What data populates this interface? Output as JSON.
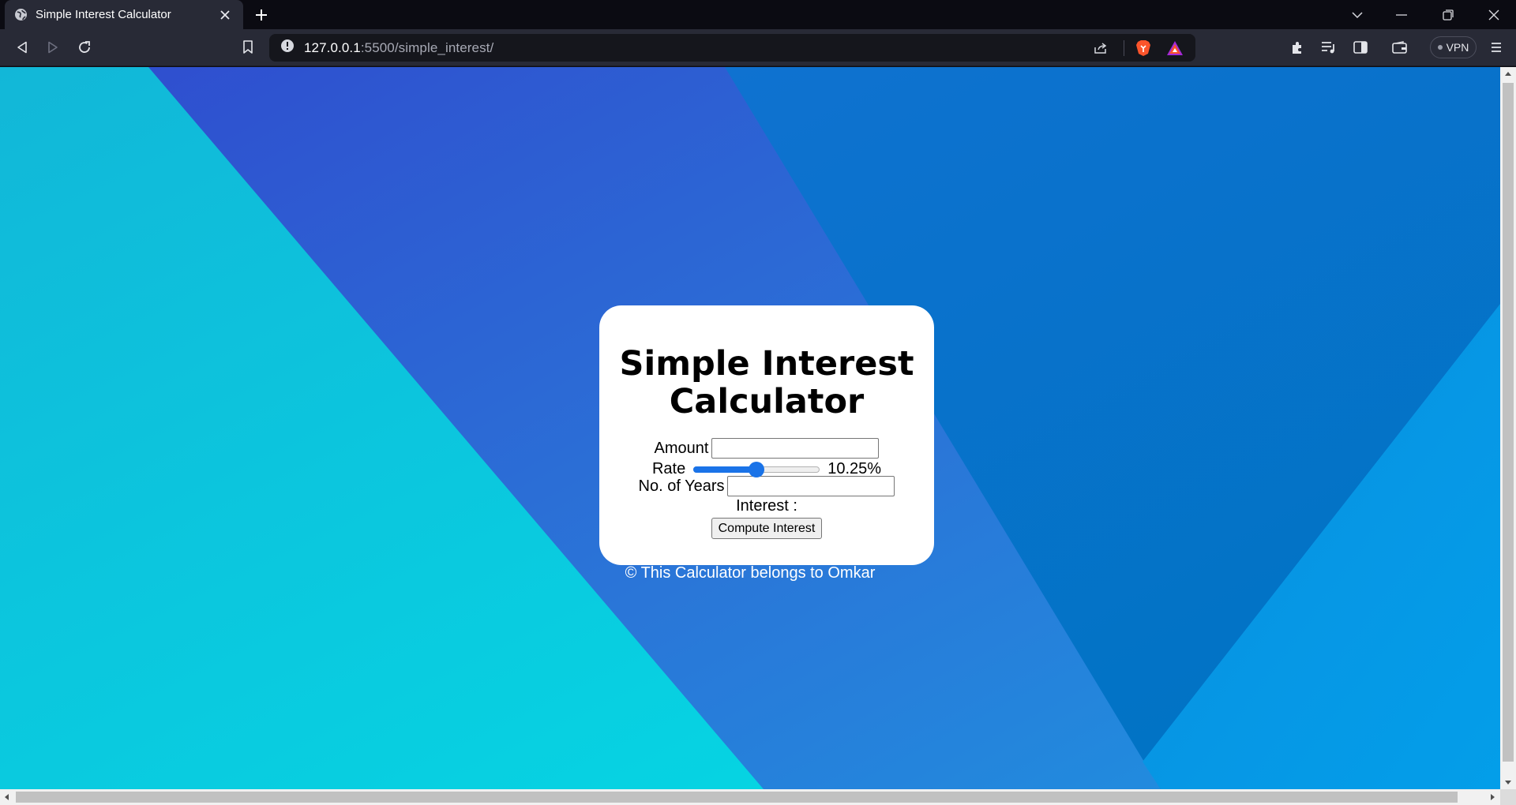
{
  "browser": {
    "tab_title": "Simple Interest Calculator",
    "url_host": "127.0.0.1",
    "url_path": ":5500/simple_interest/",
    "vpn_label": "VPN",
    "icons": [
      "globe-icon",
      "close-icon",
      "plus-icon",
      "chevron-down-icon",
      "minimize-icon",
      "restore-icon",
      "back-icon",
      "forward-icon",
      "reload-icon",
      "bookmark-icon",
      "info-icon",
      "share-icon",
      "brave-shield-icon",
      "brave-rewards-icon",
      "extensions-icon",
      "playlist-icon",
      "sidebar-icon",
      "wallet-icon",
      "menu-icon"
    ]
  },
  "page": {
    "title": "Simple Interest Calculator",
    "amount_label": "Amount",
    "amount_value": "",
    "rate_label": "Rate",
    "rate_value_text": "10.25%",
    "rate_slider_fraction": 0.5,
    "years_label": "No. of Years",
    "years_value": "",
    "interest_label": "Interest :",
    "compute_button": "Compute Interest",
    "footer": "© This Calculator belongs to Omkar"
  },
  "colors": {
    "accent": "#1a73e8",
    "chrome_bg": "#282a36",
    "page_bg_cyan": "#02dce6",
    "page_bg_blue": "#2a5fd3"
  }
}
